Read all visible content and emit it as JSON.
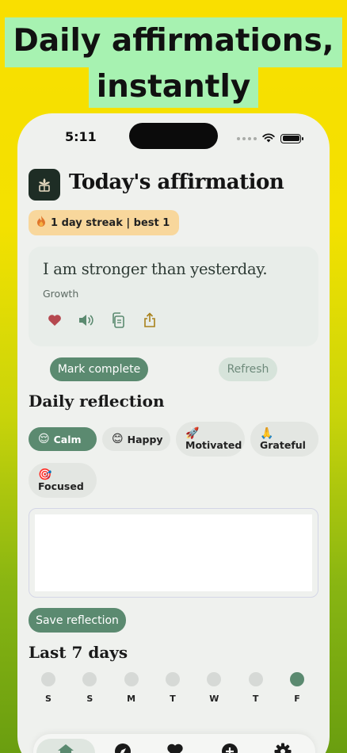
{
  "promo": {
    "headline_line1": "Daily affirmations,",
    "headline_line2": "instantly"
  },
  "status_bar": {
    "time": "5:11"
  },
  "header": {
    "title": "Today's affirmation",
    "streak_text": "1 day streak  |  best 1"
  },
  "affirmation": {
    "text": "I am stronger than yesterday.",
    "category": "Growth",
    "actions": [
      "heart-icon",
      "speaker-icon",
      "copy-icon",
      "share-icon"
    ]
  },
  "buttons": {
    "mark_complete": "Mark complete",
    "refresh": "Refresh",
    "save_reflection": "Save reflection"
  },
  "reflection": {
    "title": "Daily reflection",
    "moods": [
      {
        "emoji": "😌",
        "label": "Calm",
        "selected": true
      },
      {
        "emoji": "😊",
        "label": "Happy",
        "selected": false
      },
      {
        "emoji": "🚀",
        "label": "Motivated",
        "selected": false
      },
      {
        "emoji": "🙏",
        "label": "Grateful",
        "selected": false
      },
      {
        "emoji": "🎯",
        "label": "Focused",
        "selected": false
      }
    ],
    "input_value": ""
  },
  "history": {
    "title": "Last 7 days",
    "days": [
      {
        "label": "S",
        "done": false
      },
      {
        "label": "S",
        "done": false
      },
      {
        "label": "M",
        "done": false
      },
      {
        "label": "T",
        "done": false
      },
      {
        "label": "W",
        "done": false
      },
      {
        "label": "T",
        "done": false
      },
      {
        "label": "F",
        "done": true
      }
    ]
  },
  "tab_bar": {
    "tabs": [
      "home-icon",
      "compass-icon",
      "heart-icon",
      "add-icon",
      "gear-icon"
    ],
    "active_tab": "home-icon"
  },
  "colors": {
    "accent": "#5b8a70",
    "streak_badge": "#f8d79c",
    "headline_highlight": "#a7f2b1",
    "heart": "#b5484f",
    "share": "#a8811a"
  }
}
